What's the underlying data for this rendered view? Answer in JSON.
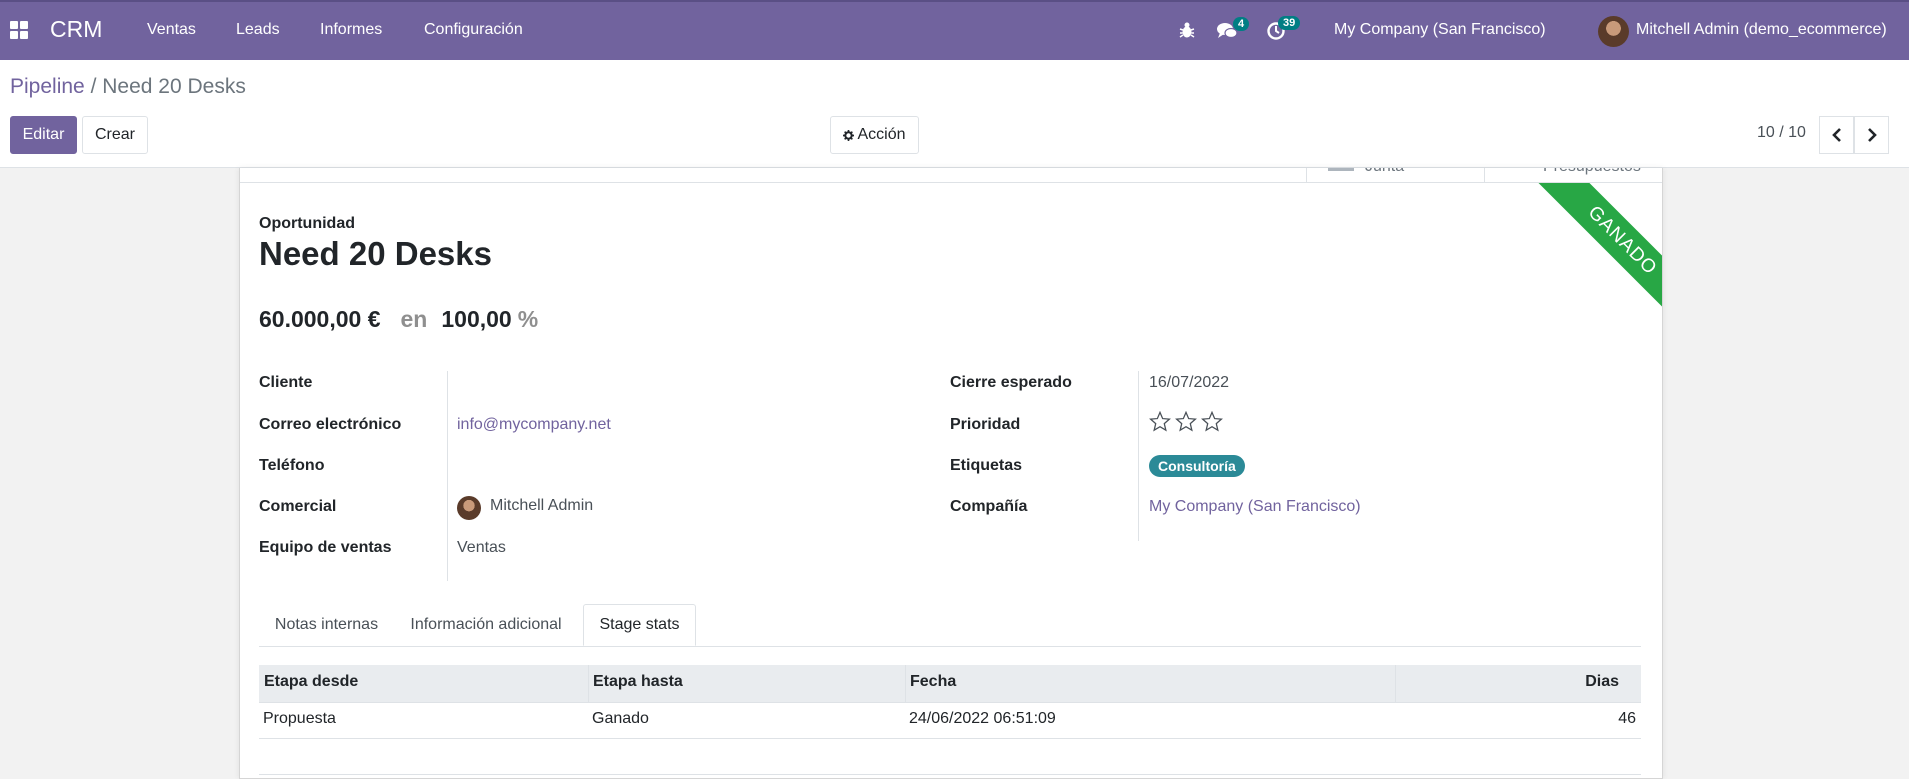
{
  "topbar": {
    "brand": "CRM",
    "menu": [
      "Ventas",
      "Leads",
      "Informes",
      "Configuración"
    ],
    "messages_count": "4",
    "activities_count": "39",
    "company": "My Company (San Francisco)",
    "user": "Mitchell Admin (demo_ecommerce)",
    "color": "#71639e"
  },
  "breadcrumb": {
    "parent": "Pipeline",
    "separator": "/",
    "current": "Need 20 Desks"
  },
  "actions": {
    "edit": "Editar",
    "create": "Crear",
    "action": "Acción"
  },
  "pager": {
    "value": "10 / 10"
  },
  "stat_buttons": [
    "Junta",
    "Presupuestos"
  ],
  "ribbon": {
    "text": "GANADO",
    "color": "#28a745"
  },
  "record": {
    "kind": "Oportunidad",
    "name": "Need 20 Desks",
    "revenue": "60.000,00 €",
    "at": "en",
    "probability": "100,00",
    "pct": "%"
  },
  "fields_left": [
    {
      "label": "Cliente",
      "value": ""
    },
    {
      "label": "Correo electrónico",
      "value": "info@mycompany.net"
    },
    {
      "label": "Teléfono",
      "value": ""
    },
    {
      "label": "Comercial",
      "value": "Mitchell Admin"
    },
    {
      "label": "Equipo de ventas",
      "value": "Ventas"
    }
  ],
  "fields_right": [
    {
      "label": "Cierre esperado",
      "value": "16/07/2022"
    },
    {
      "label": "Prioridad",
      "value": ""
    },
    {
      "label": "Etiquetas",
      "value": "Consultoría"
    },
    {
      "label": "Compañía",
      "value": "My Company (San Francisco)"
    }
  ],
  "priority": {
    "stars": 3,
    "filled": 0
  },
  "tabs": [
    "Notas internas",
    "Información adicional",
    "Stage stats"
  ],
  "stage_table": {
    "headers": [
      "Etapa desde",
      "Etapa hasta",
      "Fecha",
      "Dias"
    ],
    "rows": [
      [
        "Propuesta",
        "Ganado",
        "24/06/2022 06:51:09",
        "46"
      ]
    ]
  }
}
